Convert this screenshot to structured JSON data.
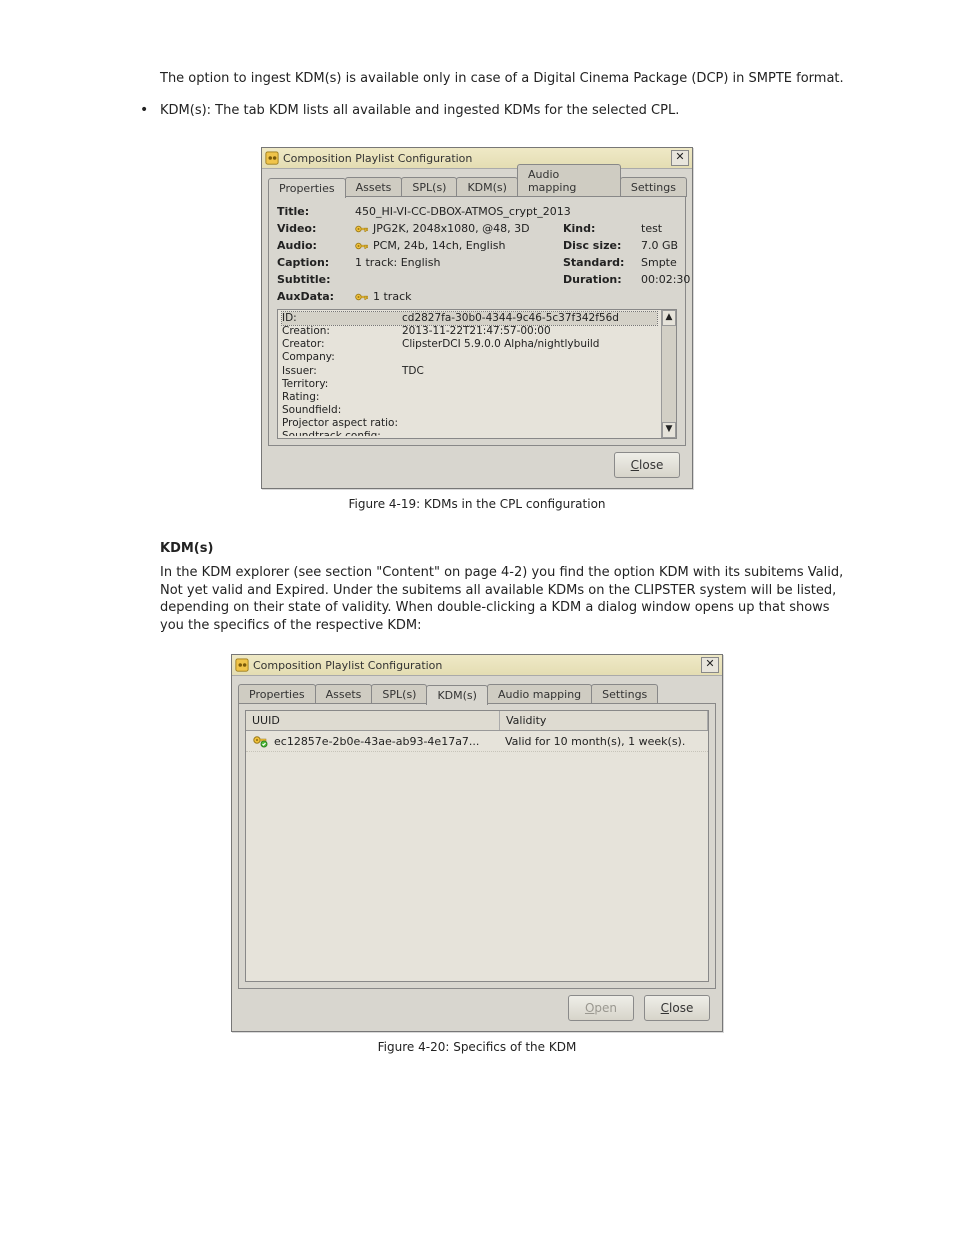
{
  "document": {
    "intro_paragraph": "The option to ingest KDM(s) is available only in case of a Digital Cinema Package (DCP) in SMPTE format.",
    "bullet_text": "KDM(s): The tab KDM lists all available and ingested KDMs for the selected CPL.",
    "kdm_section_heading": "KDM(s)",
    "kdm_paragraph_1": "In the KDM explorer (see section \"Content\" on page 4-2) you find the option KDM with its subitems Valid, Not yet valid and Expired. Under the subitems all available KDMs on the CLIPSTER system will be listed, depending on their state of validity. When double-clicking a KDM a dialog window opens up that shows you the specifics of the respective KDM:",
    "figure1_caption": "Figure 4-19: KDMs in the CPL configuration",
    "figure2_caption": "Figure 4-20: Specifics of the KDM"
  },
  "dialog1": {
    "window_title": "Composition Playlist Configuration",
    "tabs": [
      "Properties",
      "Assets",
      "SPL(s)",
      "KDM(s)",
      "Audio mapping",
      "Settings"
    ],
    "active_tab": 0,
    "fields": {
      "title_label": "Title:",
      "title_value": "450_HI-VI-CC-DBOX-ATMOS_crypt_2013",
      "video_label": "Video:",
      "video_value": "JPG2K, 2048x1080, @48, 3D",
      "audio_label": "Audio:",
      "audio_value": "PCM, 24b, 14ch, English",
      "caption_label": "Caption:",
      "caption_value": "1 track: English",
      "subtitle_label": "Subtitle:",
      "subtitle_value": "",
      "auxdata_label": "AuxData:",
      "auxdata_value": "1 track",
      "kind_label": "Kind:",
      "kind_value": "test",
      "discsize_label": "Disc size:",
      "discsize_value": "7.0 GB",
      "standard_label": "Standard:",
      "standard_value": "Smpte",
      "duration_label": "Duration:",
      "duration_value": "00:02:30"
    },
    "metadata": [
      {
        "label": "ID:",
        "value": "cd2827fa-30b0-4344-9c46-5c37f342f56d"
      },
      {
        "label": "Creation:",
        "value": "2013-11-22T21:47:57-00:00"
      },
      {
        "label": "Creator:",
        "value": "ClipsterDCI 5.9.0.0 Alpha/nightlybuild"
      },
      {
        "label": "Company:",
        "value": ""
      },
      {
        "label": "Issuer:",
        "value": "TDC"
      },
      {
        "label": "Territory:",
        "value": ""
      },
      {
        "label": "Rating:",
        "value": ""
      },
      {
        "label": "Soundfield:",
        "value": ""
      },
      {
        "label": "Projector aspect ratio:",
        "value": ""
      },
      {
        "label": "Soundtrack config:",
        "value": ""
      }
    ],
    "close_label": "Close"
  },
  "dialog2": {
    "window_title": "Composition Playlist Configuration",
    "tabs": [
      "Properties",
      "Assets",
      "SPL(s)",
      "KDM(s)",
      "Audio mapping",
      "Settings"
    ],
    "active_tab": 3,
    "columns": {
      "uuid": "UUID",
      "validity": "Validity"
    },
    "rows": [
      {
        "uuid": "ec12857e-2b0e-43ae-ab93-4e17a7...",
        "validity": "Valid for 10 month(s), 1 week(s)."
      }
    ],
    "open_label": "Open",
    "close_label": "Close"
  }
}
